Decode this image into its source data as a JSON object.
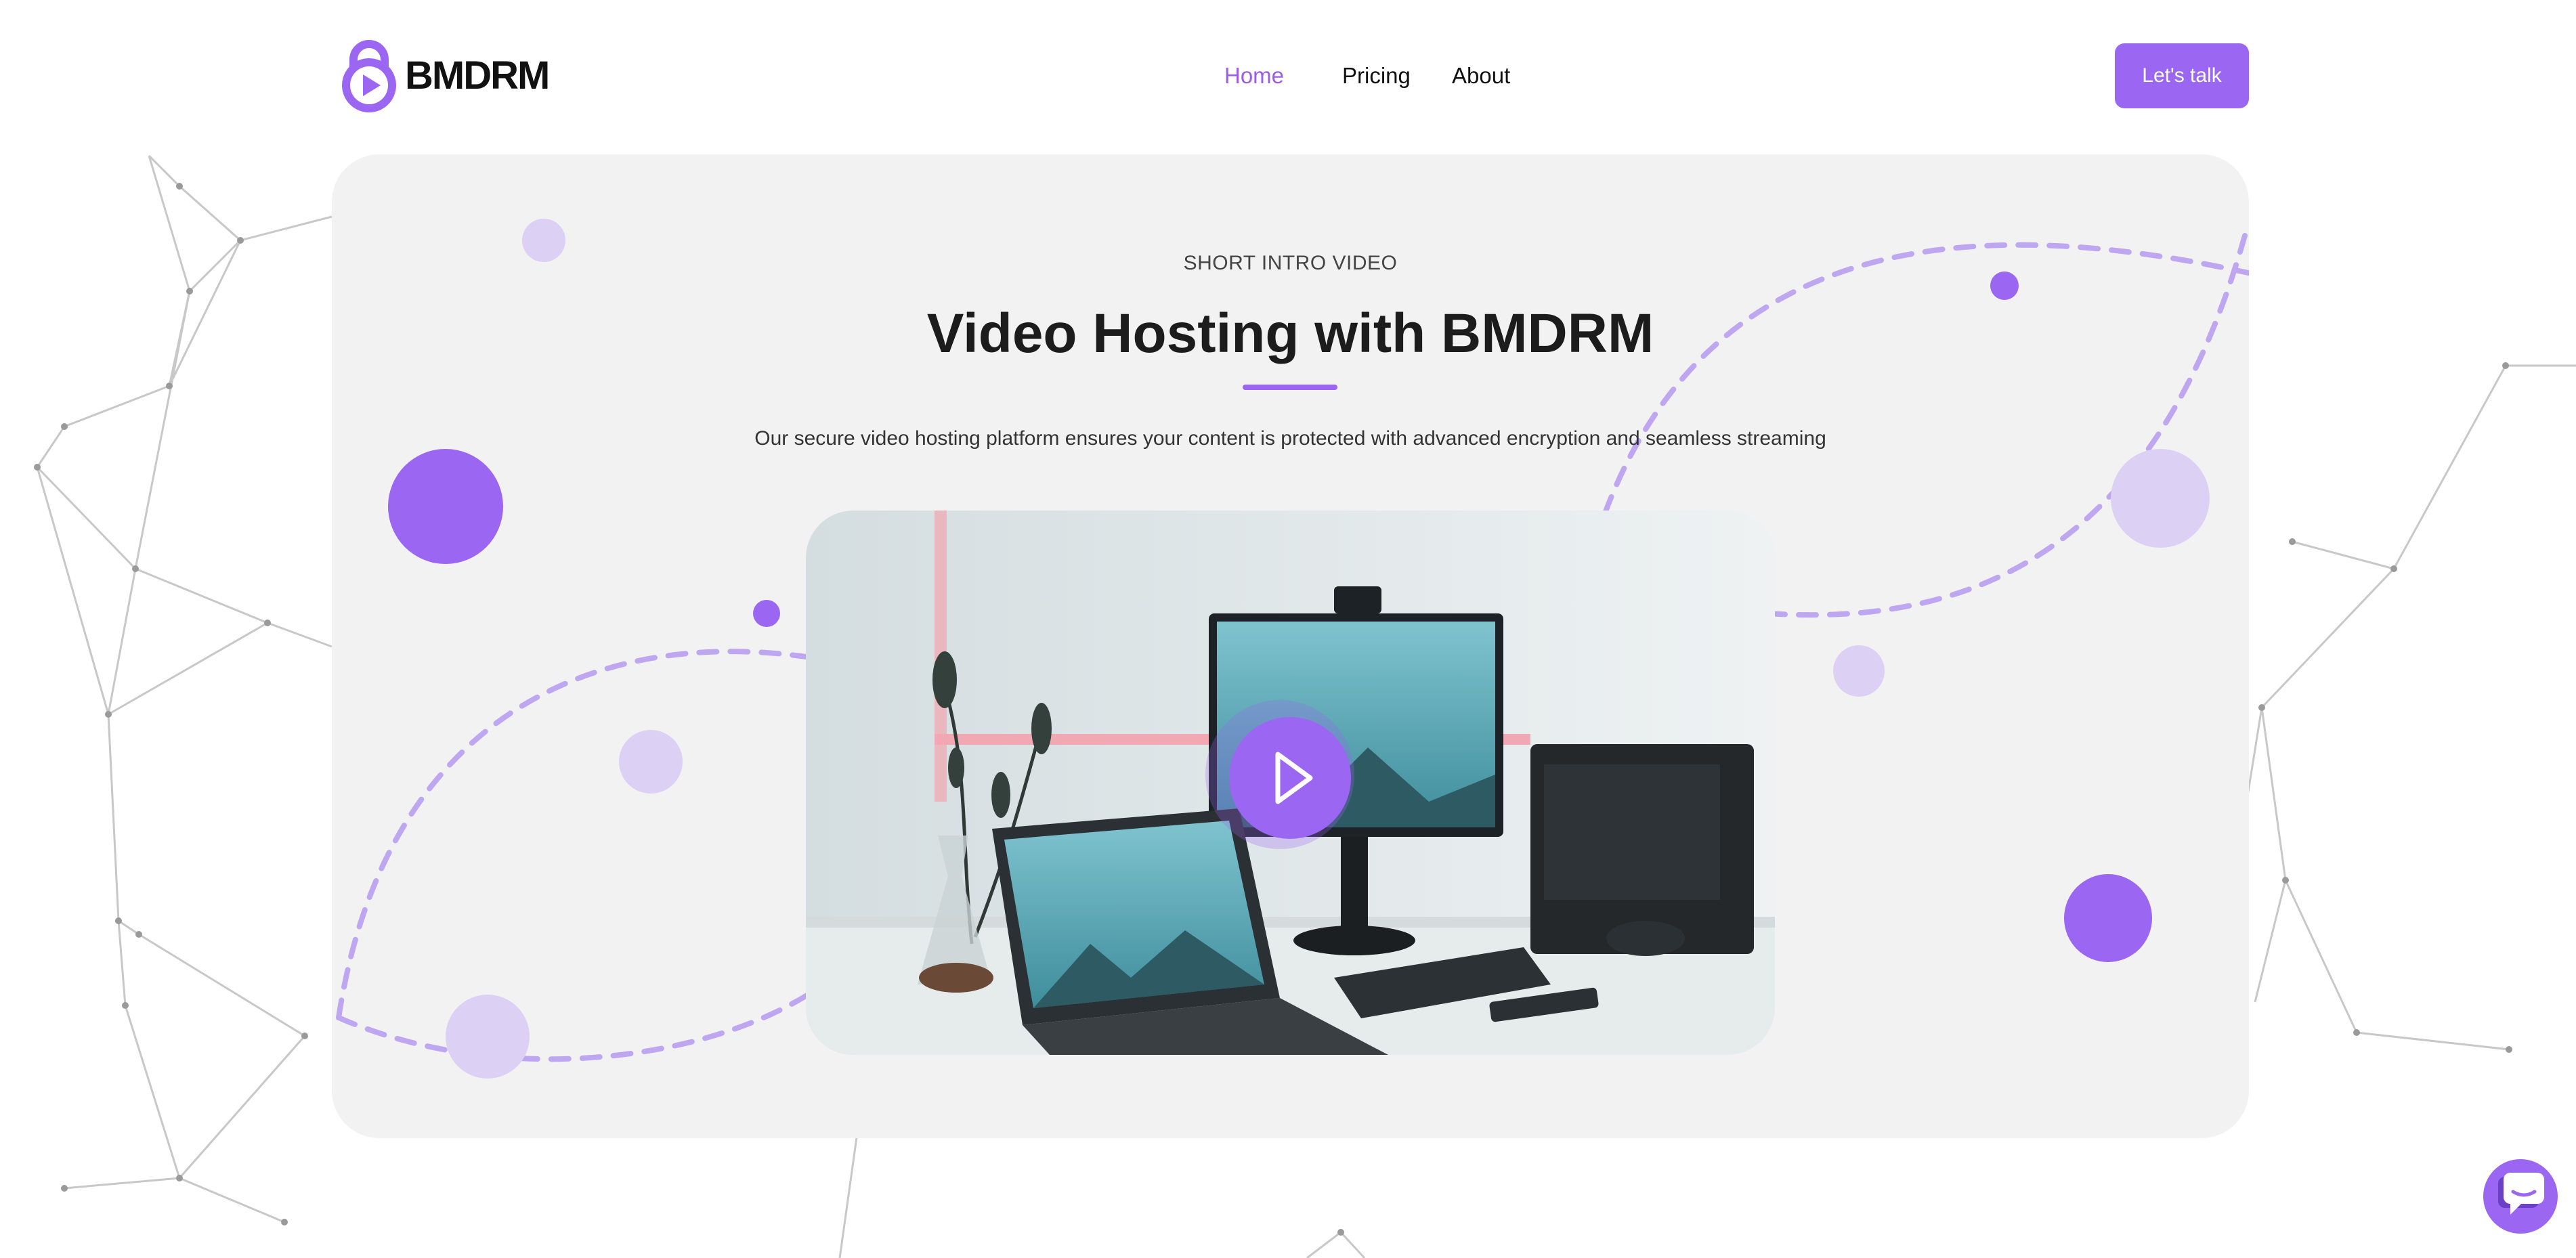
{
  "brand": {
    "name": "BMDRM",
    "accent": "#9b66f2"
  },
  "nav": {
    "items": [
      {
        "label": "Home",
        "active": true
      },
      {
        "label": "Pricing",
        "active": false
      },
      {
        "label": "About",
        "active": false
      }
    ],
    "cta_label": "Let's talk"
  },
  "hero": {
    "eyebrow": "SHORT INTRO VIDEO",
    "title": "Video Hosting with BMDRM",
    "subtitle": "Our secure video hosting platform ensures your content is protected with advanced encryption and seamless streaming"
  },
  "video": {
    "play_icon": "play-icon"
  },
  "chat": {
    "icon": "chat-bubble-icon"
  },
  "colors": {
    "card_bg": "#f2f2f2",
    "accent": "#9b66f2",
    "accent_light": "#ddd0f5"
  }
}
